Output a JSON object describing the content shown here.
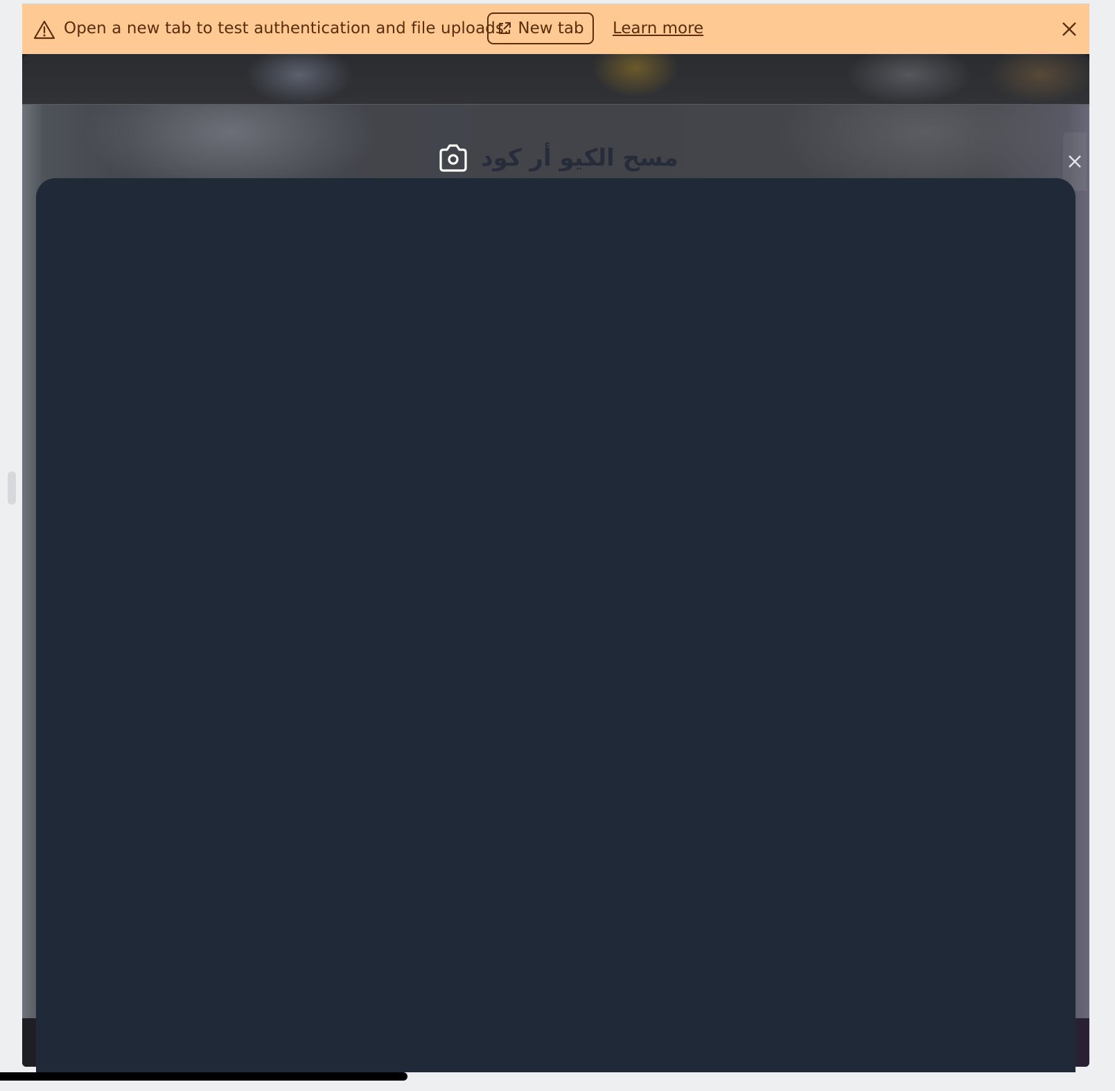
{
  "banner": {
    "icon": "warning-triangle-icon",
    "message": "Open a new tab to test authentication and file uploads.",
    "new_tab_label": "New tab",
    "new_tab_icon": "external-link-icon",
    "learn_more_label": "Learn more",
    "close_icon": "close-icon"
  },
  "modal": {
    "title": "مسح الكيو أر كود",
    "title_icon": "camera-icon",
    "close_icon": "close-icon"
  },
  "colors": {
    "banner_bg": "#ffc994",
    "banner_text": "#5a2d0c",
    "scanner_bg": "#202938",
    "page_bg": "#eeeff1"
  }
}
